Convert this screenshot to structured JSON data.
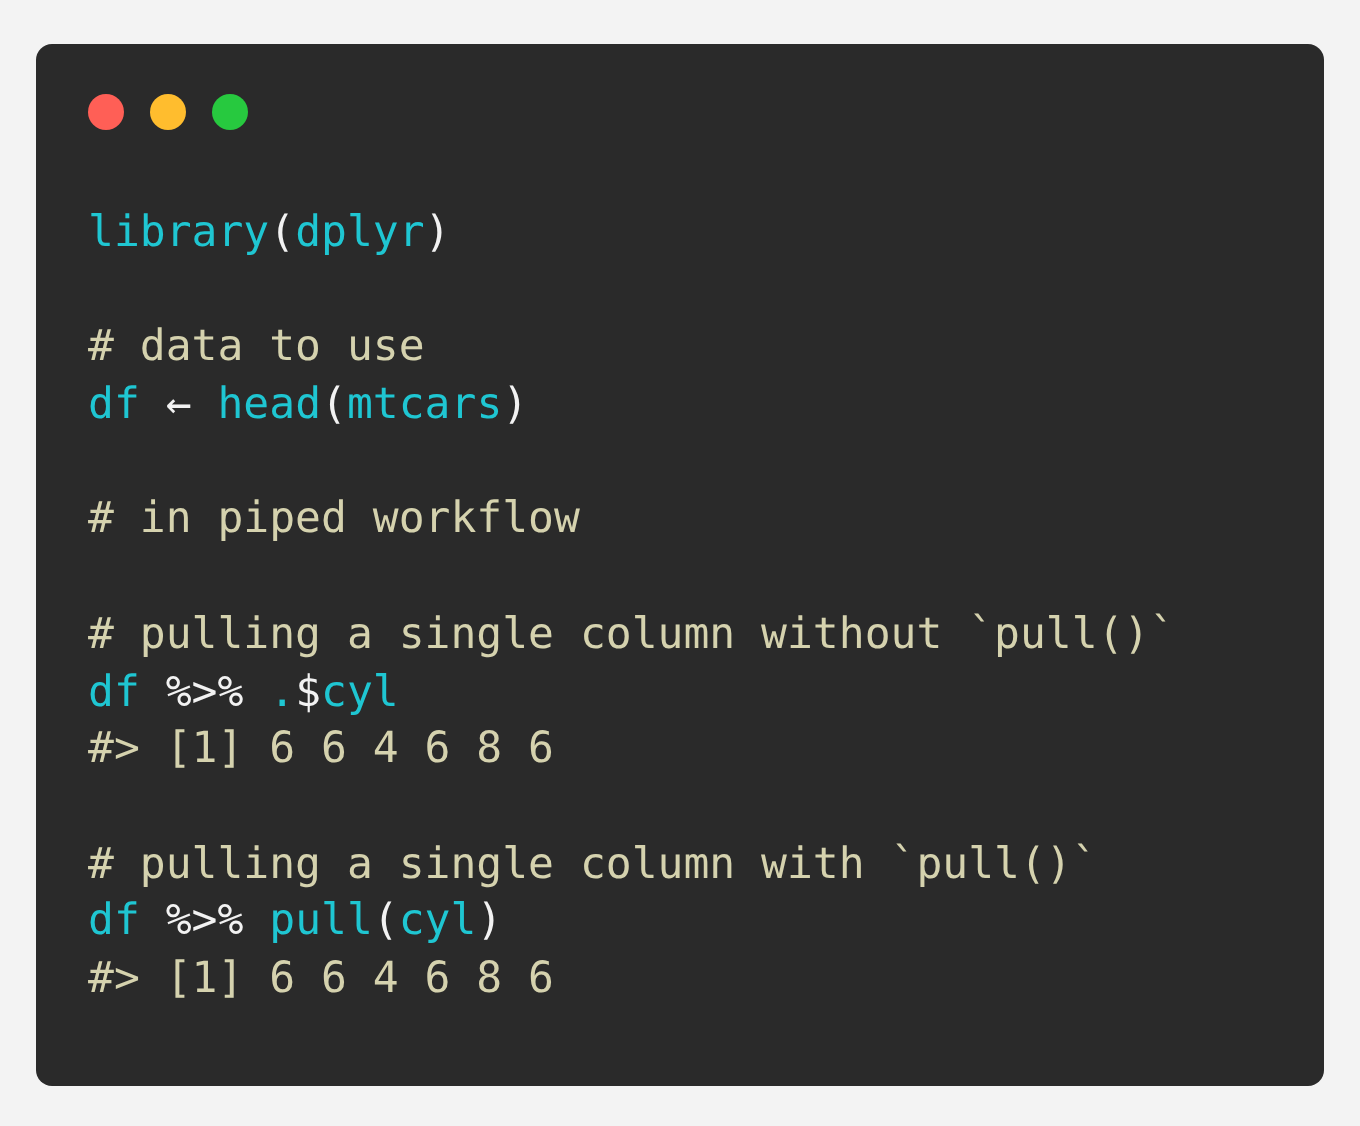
{
  "window": {
    "controls": [
      {
        "color": "#ff5f56"
      },
      {
        "color": "#ffbd2e"
      },
      {
        "color": "#27c93f"
      }
    ]
  },
  "code": [
    {
      "kind": "code",
      "tokens": [
        {
          "kind": "ident",
          "text": "library"
        },
        {
          "kind": "punct",
          "text": "("
        },
        {
          "kind": "ident",
          "text": "dplyr"
        },
        {
          "kind": "punct",
          "text": ")"
        }
      ]
    },
    {
      "kind": "blank"
    },
    {
      "kind": "code",
      "tokens": [
        {
          "kind": "comment",
          "text": "# data to use"
        }
      ]
    },
    {
      "kind": "code",
      "tokens": [
        {
          "kind": "ident",
          "text": "df"
        },
        {
          "kind": "punct",
          "text": " ← "
        },
        {
          "kind": "ident",
          "text": "head"
        },
        {
          "kind": "punct",
          "text": "("
        },
        {
          "kind": "ident",
          "text": "mtcars"
        },
        {
          "kind": "punct",
          "text": ")"
        }
      ]
    },
    {
      "kind": "blank"
    },
    {
      "kind": "code",
      "tokens": [
        {
          "kind": "comment",
          "text": "# in piped workflow"
        }
      ]
    },
    {
      "kind": "blank"
    },
    {
      "kind": "code",
      "tokens": [
        {
          "kind": "comment",
          "text": "# pulling a single column without `pull()`"
        }
      ]
    },
    {
      "kind": "code",
      "tokens": [
        {
          "kind": "ident",
          "text": "df"
        },
        {
          "kind": "punct",
          "text": " %>% "
        },
        {
          "kind": "ident",
          "text": "."
        },
        {
          "kind": "punct",
          "text": "$"
        },
        {
          "kind": "ident",
          "text": "cyl"
        }
      ]
    },
    {
      "kind": "code",
      "tokens": [
        {
          "kind": "comment",
          "text": "#> [1] 6 6 4 6 8 6"
        }
      ]
    },
    {
      "kind": "blank"
    },
    {
      "kind": "code",
      "tokens": [
        {
          "kind": "comment",
          "text": "# pulling a single column with `pull()`"
        }
      ]
    },
    {
      "kind": "code",
      "tokens": [
        {
          "kind": "ident",
          "text": "df"
        },
        {
          "kind": "punct",
          "text": " %>% "
        },
        {
          "kind": "ident",
          "text": "pull"
        },
        {
          "kind": "punct",
          "text": "("
        },
        {
          "kind": "ident",
          "text": "cyl"
        },
        {
          "kind": "punct",
          "text": ")"
        }
      ]
    },
    {
      "kind": "code",
      "tokens": [
        {
          "kind": "comment",
          "text": "#> [1] 6 6 4 6 8 6"
        }
      ]
    }
  ]
}
